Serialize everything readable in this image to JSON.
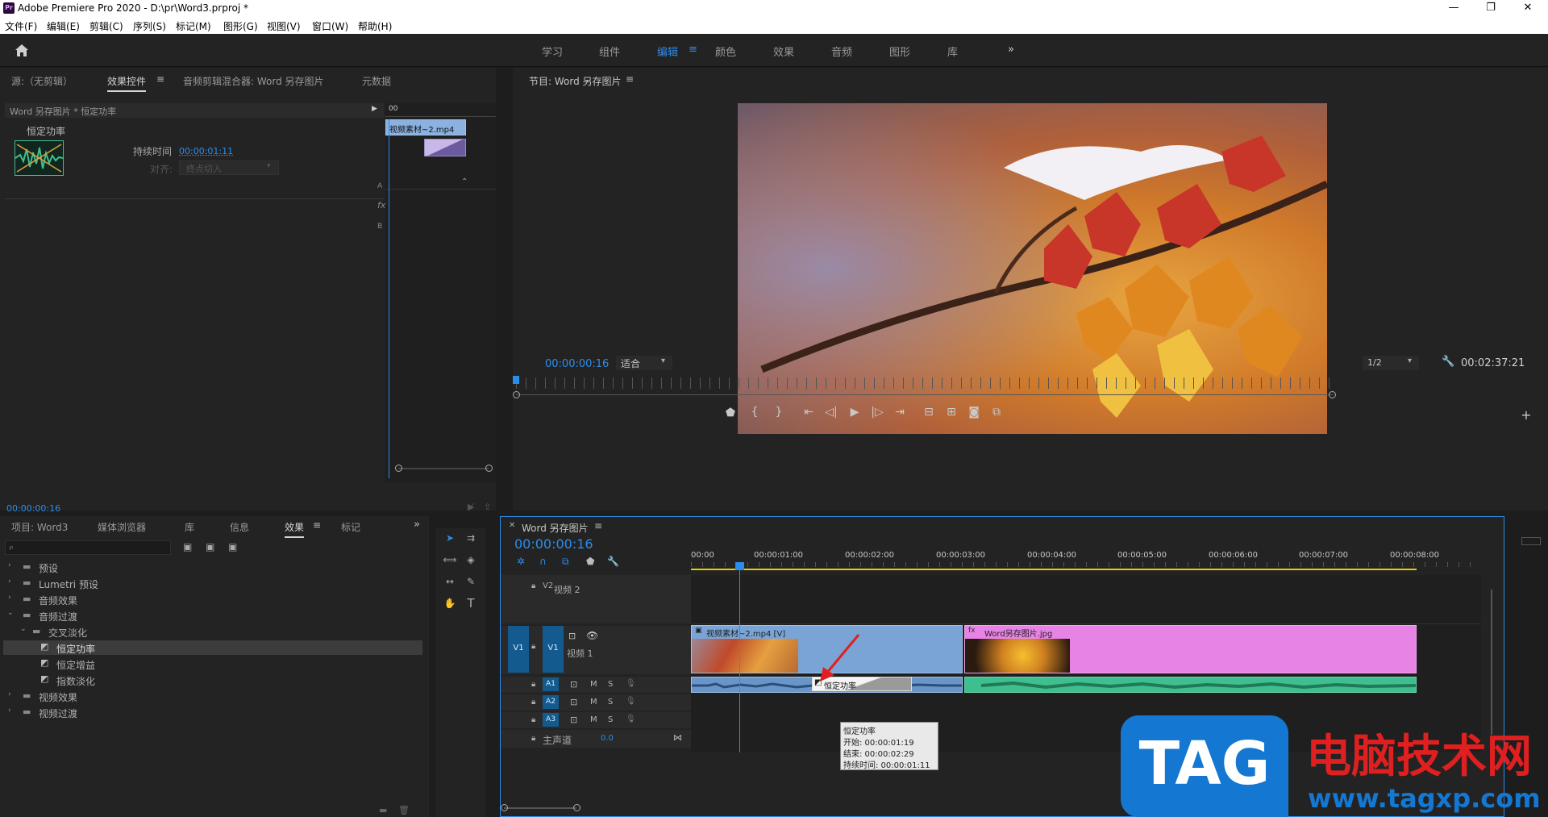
{
  "app": {
    "title": "Adobe Premiere Pro 2020 - D:\\pr\\Word3.prproj *",
    "logo": "Pr",
    "window_controls": [
      "—",
      "❐",
      "✕"
    ]
  },
  "menu": [
    "文件(F)",
    "编辑(E)",
    "剪辑(C)",
    "序列(S)",
    "标记(M)",
    "图形(G)",
    "视图(V)",
    "窗口(W)",
    "帮助(H)"
  ],
  "workspaces": {
    "items": [
      "学习",
      "组件",
      "编辑",
      "颜色",
      "效果",
      "音频",
      "图形",
      "库"
    ],
    "active": "编辑",
    "more": "»"
  },
  "source_panel": {
    "tabs": [
      "源:（无剪辑）",
      "效果控件",
      "音频剪辑混合器: Word 另存图片",
      "元数据"
    ],
    "active_tab": "效果控件",
    "path": "Word 另存图片 * 恒定功率",
    "effect_name": "恒定功率",
    "duration_label": "持续时间",
    "duration_value": "00:00:01:11",
    "align_label": "对齐:",
    "align_value": "终点切入",
    "ruler_start": "00",
    "clip_label": "视频素材~2.mp4",
    "row_a": "A",
    "row_fx": "fx",
    "row_b": "B",
    "timecode": "00:00:00:16"
  },
  "program_monitor": {
    "title": "节目: Word 另存图片",
    "timecode": "00:00:00:16",
    "fit": "适合",
    "resolution": "1/2",
    "duration": "00:02:37:21"
  },
  "project_panel": {
    "tabs": [
      "项目: Word3",
      "媒体浏览器",
      "库",
      "信息",
      "效果",
      "标记"
    ],
    "active_tab": "效果",
    "search_placeholder": "",
    "tree": [
      {
        "label": "预设",
        "level": 0,
        "expanded": false,
        "type": "folder"
      },
      {
        "label": "Lumetri 预设",
        "level": 0,
        "expanded": false,
        "type": "folder"
      },
      {
        "label": "音频效果",
        "level": 0,
        "expanded": false,
        "type": "folder"
      },
      {
        "label": "音频过渡",
        "level": 0,
        "expanded": true,
        "type": "folder"
      },
      {
        "label": "交叉淡化",
        "level": 1,
        "expanded": true,
        "type": "folder"
      },
      {
        "label": "恒定功率",
        "level": 2,
        "type": "effect",
        "selected": true
      },
      {
        "label": "恒定增益",
        "level": 2,
        "type": "effect"
      },
      {
        "label": "指数淡化",
        "level": 2,
        "type": "effect"
      },
      {
        "label": "视频效果",
        "level": 0,
        "expanded": false,
        "type": "folder"
      },
      {
        "label": "视频过渡",
        "level": 0,
        "expanded": false,
        "type": "folder"
      }
    ]
  },
  "timeline": {
    "title": "Word 另存图片",
    "timecode": "00:00:00:16",
    "ruler": [
      "00:00",
      "00:00:01:00",
      "00:00:02:00",
      "00:00:03:00",
      "00:00:04:00",
      "00:00:05:00",
      "00:00:06:00",
      "00:00:07:00",
      "00:00:08:00"
    ],
    "tracks": {
      "v2": {
        "target": "V2",
        "name": "视频 2"
      },
      "v1": {
        "src": "V1",
        "target": "V1",
        "name": "视频 1"
      },
      "a1": {
        "target": "A1"
      },
      "a2": {
        "target": "A2"
      },
      "a3": {
        "target": "A3"
      },
      "master": {
        "name": "主声道",
        "value": "0.0"
      }
    },
    "btn_m": "M",
    "btn_s": "S",
    "clips": {
      "video1": "视频素材~2.mp4 [V]",
      "image1": "Word另存图片.jpg",
      "transition": "恒定功率"
    },
    "tooltip": {
      "name": "恒定功率",
      "start": "开始: 00:00:01:19",
      "end": "结束: 00:00:02:29",
      "duration": "持续时间: 00:00:01:11"
    }
  },
  "watermark": {
    "tag": "TAG",
    "site_cn": "电脑技术网",
    "url": "www.tagxp.com"
  },
  "colors": {
    "accent": "#2d8ceb",
    "video_clip": "#6a95c8",
    "image_clip": "#e27ee0",
    "audio_clip": "#3fbf8f",
    "playhead": "#2d8ceb"
  }
}
